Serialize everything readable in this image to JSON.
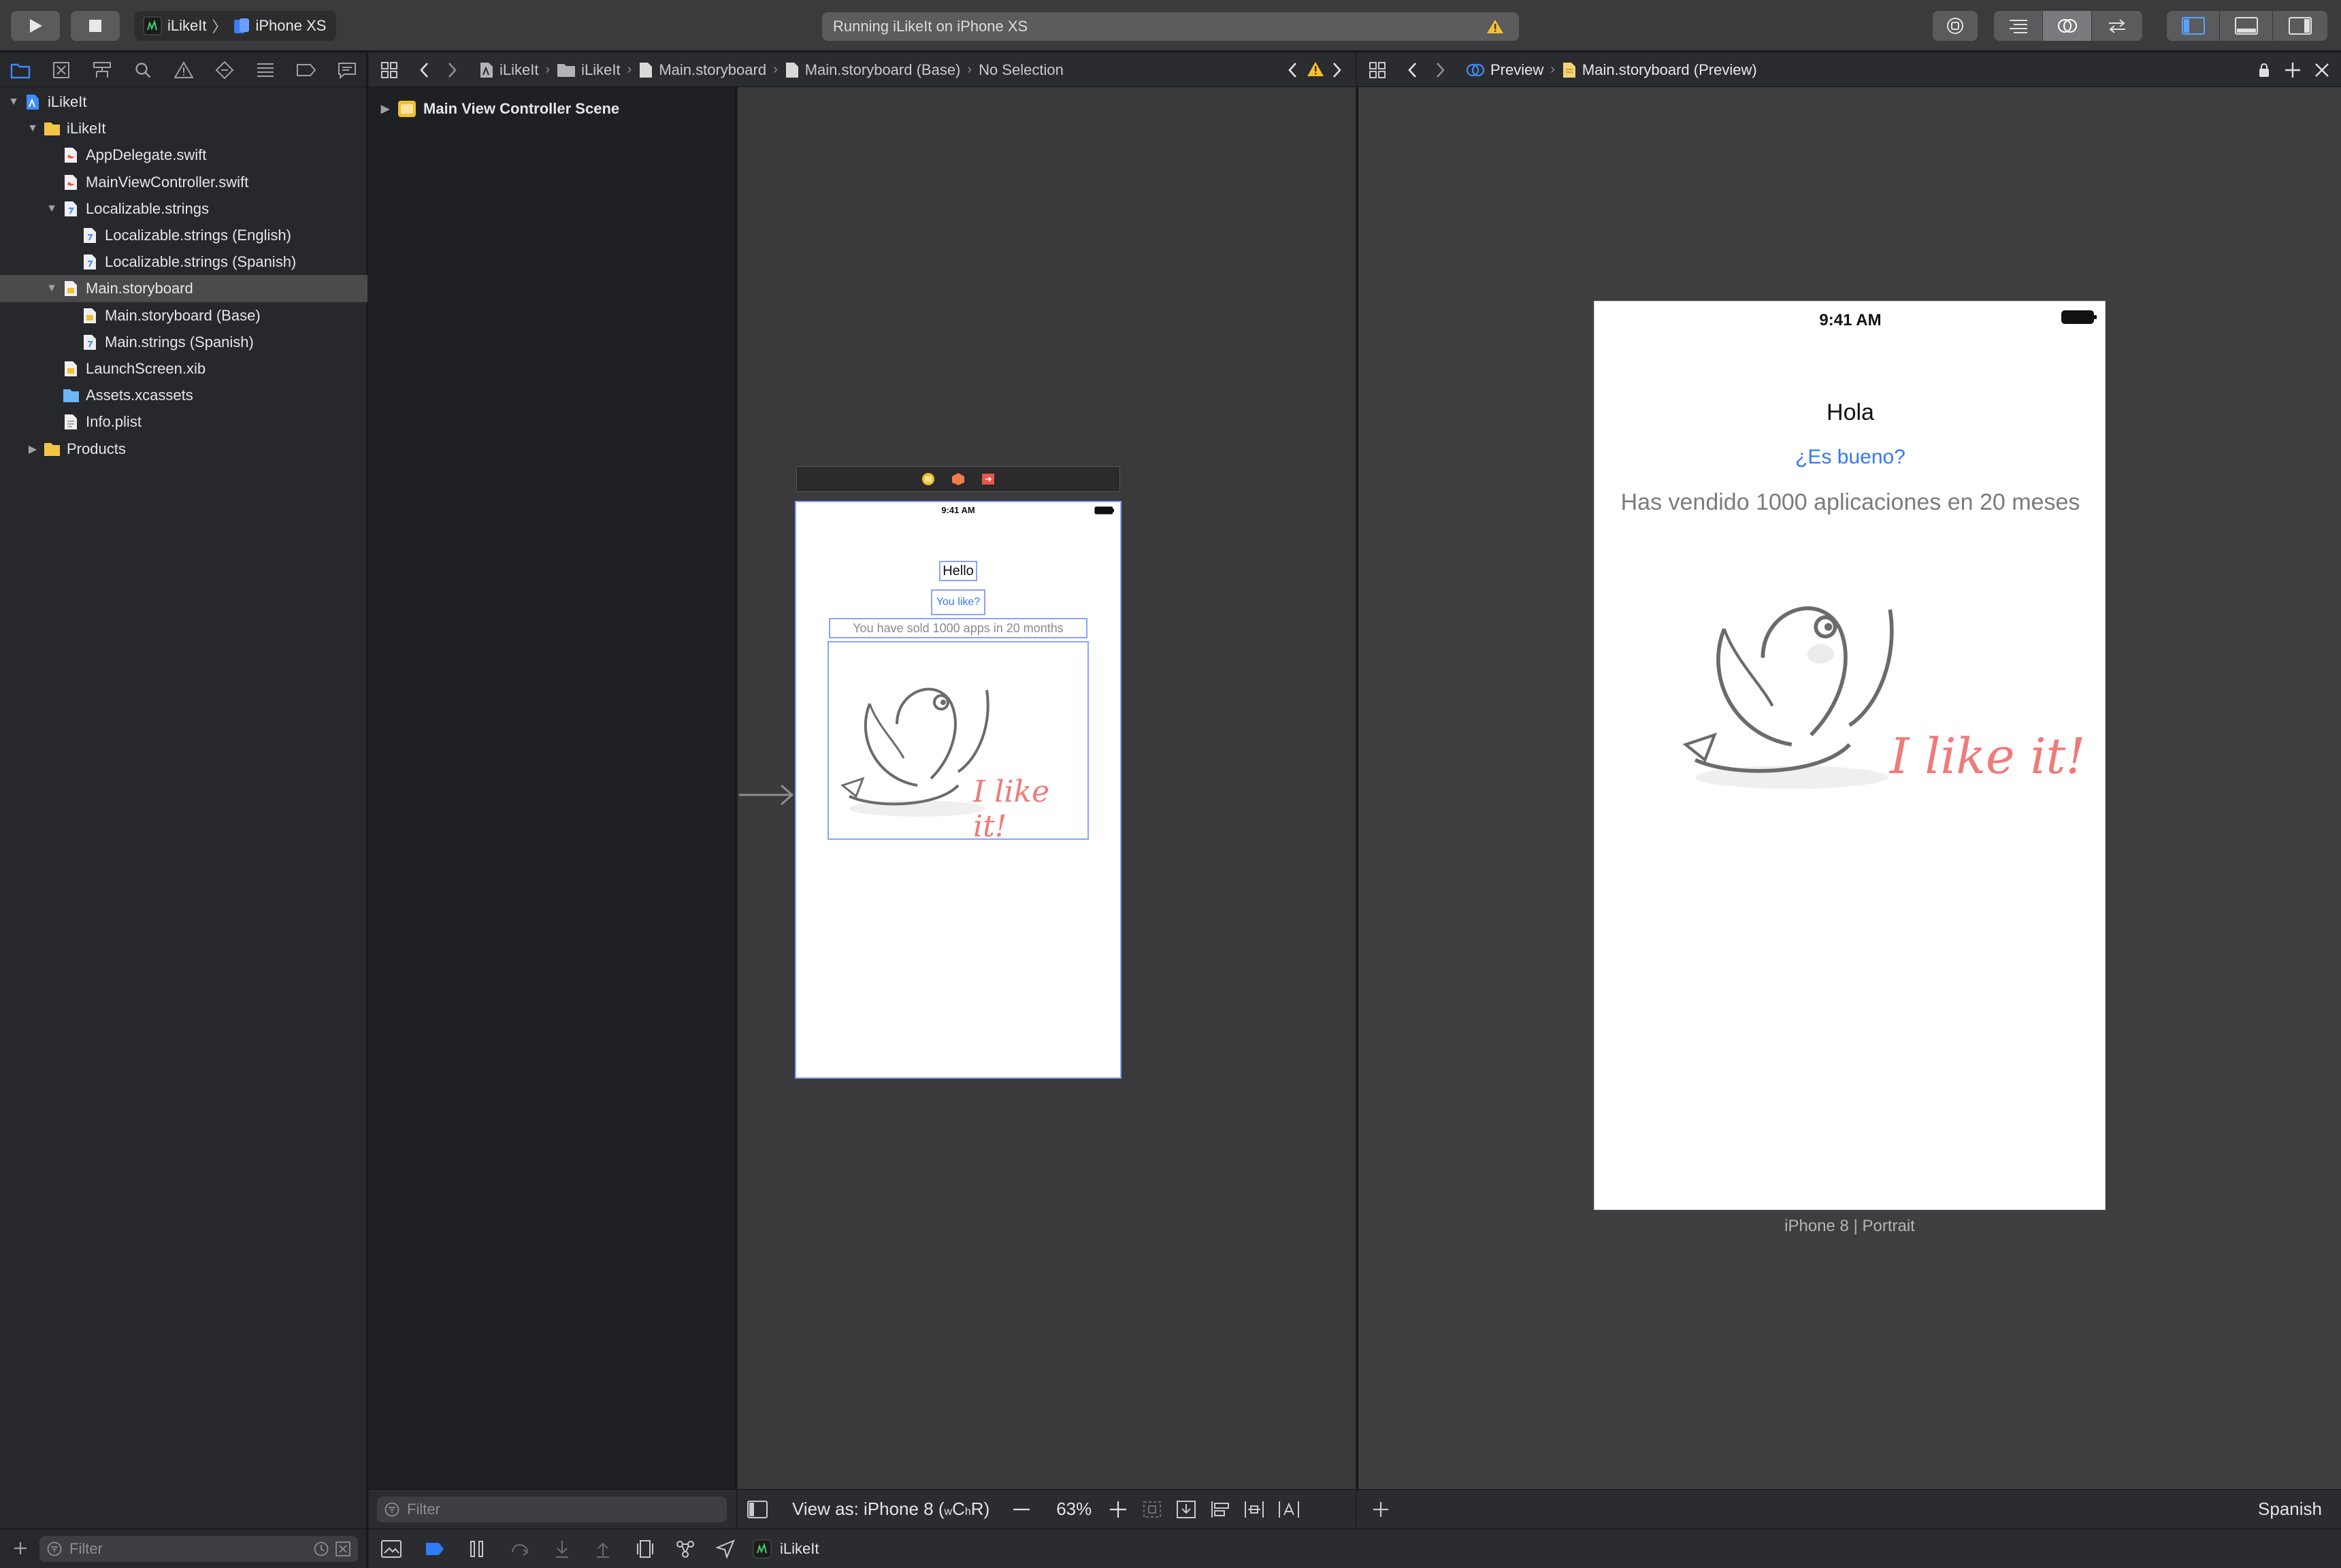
{
  "toolbar": {
    "scheme_target": "iLikeIt",
    "scheme_device": "iPhone XS",
    "activity_status": "Running iLikeIt on iPhone XS",
    "warning_icon": "warning-triangle-icon"
  },
  "navigator": {
    "tree": [
      {
        "label": "iLikeIt",
        "level": 0,
        "icon": "project-icon",
        "expanded": true
      },
      {
        "label": "iLikeIt",
        "level": 1,
        "icon": "folder-icon",
        "expanded": true
      },
      {
        "label": "AppDelegate.swift",
        "level": 2,
        "icon": "swift-file-icon"
      },
      {
        "label": "MainViewController.swift",
        "level": 2,
        "icon": "swift-file-icon"
      },
      {
        "label": "Localizable.strings",
        "level": 2,
        "icon": "strings-file-icon",
        "expanded": true
      },
      {
        "label": "Localizable.strings (English)",
        "level": 3,
        "icon": "strings-file-icon"
      },
      {
        "label": "Localizable.strings (Spanish)",
        "level": 3,
        "icon": "strings-file-icon"
      },
      {
        "label": "Main.storyboard",
        "level": 2,
        "icon": "storyboard-file-icon",
        "expanded": true,
        "selected": true
      },
      {
        "label": "Main.storyboard (Base)",
        "level": 3,
        "icon": "storyboard-file-icon"
      },
      {
        "label": "Main.strings (Spanish)",
        "level": 3,
        "icon": "strings-file-icon"
      },
      {
        "label": "LaunchScreen.xib",
        "level": 2,
        "icon": "xib-file-icon"
      },
      {
        "label": "Assets.xcassets",
        "level": 2,
        "icon": "asset-folder-icon"
      },
      {
        "label": "Info.plist",
        "level": 2,
        "icon": "plist-file-icon"
      },
      {
        "label": "Products",
        "level": 1,
        "icon": "folder-icon",
        "expanded": false
      }
    ],
    "filter_placeholder": "Filter"
  },
  "jumpbar_left": {
    "crumbs": [
      "iLikeIt",
      "iLikeIt",
      "Main.storyboard",
      "Main.storyboard (Base)",
      "No Selection"
    ]
  },
  "outline": {
    "scene_label": "Main View Controller Scene",
    "filter_placeholder": "Filter"
  },
  "storyboard_scene": {
    "status_time": "9:41 AM",
    "title_label": "Hello",
    "button_label": "You like?",
    "sold_label": "You have sold 1000 apps in 20 months",
    "image_caption": "I like it!"
  },
  "canvas_bottom": {
    "view_as": "View as: iPhone 8 (",
    "size_class_w": "w",
    "size_class_c": "C ",
    "size_class_h": "h",
    "size_class_r": "R)",
    "zoom": "63%"
  },
  "jumpbar_right": {
    "crumbs": [
      "Preview",
      "Main.storyboard (Preview)"
    ]
  },
  "preview": {
    "status_time": "9:41 AM",
    "title_label": "Hola",
    "button_label": "¿Es bueno?",
    "sold_label": "Has vendido 1000 aplicaciones en 20 meses",
    "image_caption": "I like it!",
    "device_caption": "iPhone 8 | Portrait",
    "language": "Spanish"
  },
  "debug": {
    "target": "iLikeIt"
  },
  "colors": {
    "accent_blue": "#2f7cf6",
    "link_blue": "#3478f6",
    "caption_red": "#ef7a78",
    "warning_yellow": "#f5c12e"
  }
}
